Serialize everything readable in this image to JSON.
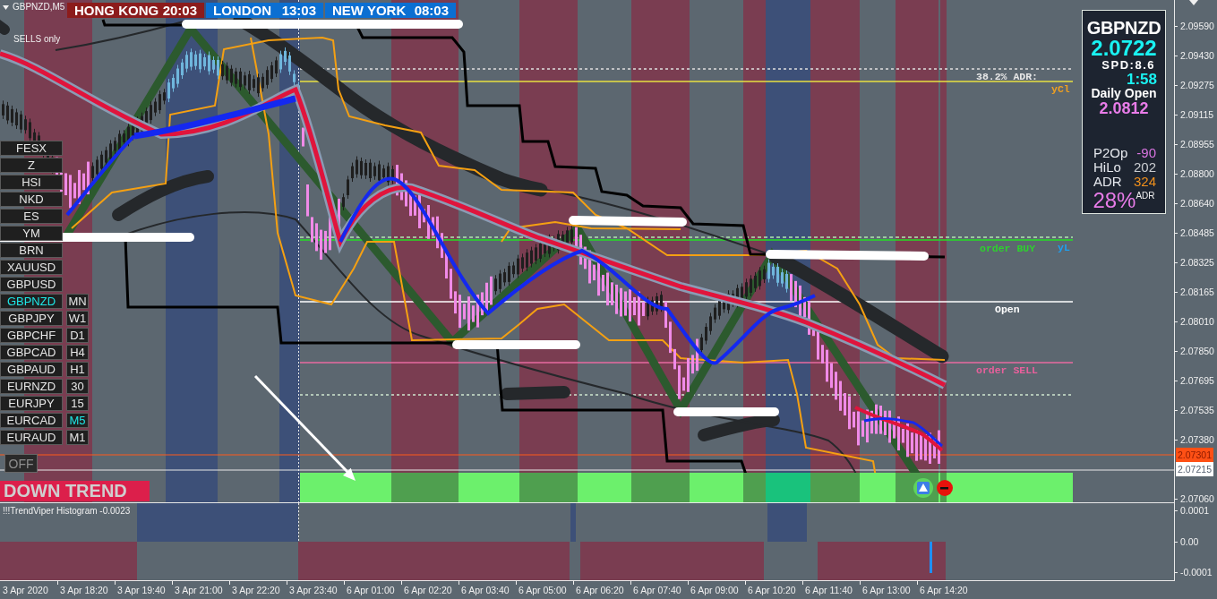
{
  "chart_header": {
    "symbol_timeframe": "GBPNZD,M5",
    "mode": "SELLS only"
  },
  "sessions": [
    {
      "name": "HONG KONG",
      "time": "20:03",
      "color": "#8c1c1c"
    },
    {
      "name": "LONDON",
      "time": "13:03",
      "color": "#0b6fd2"
    },
    {
      "name": "NEW YORK",
      "time": "08:03",
      "color": "#0b6fd2"
    }
  ],
  "info_panel": {
    "symbol": "GBPNZD",
    "price": "2.0722",
    "spread": "SPD:8.6",
    "timer": "1:58",
    "daily_open_label": "Daily Open",
    "daily_open": "2.0812",
    "stats": [
      {
        "label": "P2Op",
        "value": "-90",
        "color": "#d874e0"
      },
      {
        "label": "HiLo",
        "value": "202",
        "color": "#c9ccd0"
      },
      {
        "label": "ADR",
        "value": "324",
        "color": "#f0901c"
      }
    ],
    "adr_percent": "28%",
    "adr_percent_suffix": "ADR"
  },
  "symbols": [
    {
      "name": "FESX",
      "selected": false
    },
    {
      "name": "Z",
      "selected": false
    },
    {
      "name": "HSI",
      "selected": false
    },
    {
      "name": "NKD",
      "selected": false
    },
    {
      "name": "ES",
      "selected": false
    },
    {
      "name": "YM",
      "selected": false
    },
    {
      "name": "BRN",
      "selected": false
    },
    {
      "name": "XAUUSD",
      "selected": false
    },
    {
      "name": "GBPUSD",
      "selected": false
    },
    {
      "name": "GBPNZD",
      "selected": true
    },
    {
      "name": "GBPJPY",
      "selected": false
    },
    {
      "name": "GBPCHF",
      "selected": false
    },
    {
      "name": "GBPCAD",
      "selected": false
    },
    {
      "name": "GBPAUD",
      "selected": false
    },
    {
      "name": "EURNZD",
      "selected": false
    },
    {
      "name": "EURJPY",
      "selected": false
    },
    {
      "name": "EURCAD",
      "selected": false
    },
    {
      "name": "EURAUD",
      "selected": false
    }
  ],
  "timeframes": [
    {
      "label": "MN",
      "selected": false
    },
    {
      "label": "W1",
      "selected": false
    },
    {
      "label": "D1",
      "selected": false
    },
    {
      "label": "H4",
      "selected": false
    },
    {
      "label": "H1",
      "selected": false
    },
    {
      "label": "30",
      "selected": false
    },
    {
      "label": "15",
      "selected": false
    },
    {
      "label": "M5",
      "selected": true
    },
    {
      "label": "M1",
      "selected": false
    }
  ],
  "toggle": {
    "label": "OFF",
    "on": false
  },
  "trend_banner": "DOWN TREND",
  "level_labels": [
    {
      "kind": "adr",
      "text": "38.2% ADR:",
      "color": "#e8e8e8"
    },
    {
      "kind": "yclose",
      "text": "yCl",
      "color": "#f0a020"
    },
    {
      "kind": "buy",
      "text": "order BUY",
      "color": "#2ed12e"
    },
    {
      "kind": "ylow",
      "text": "yL",
      "color": "#1ea0f0"
    },
    {
      "kind": "open",
      "text": "Open",
      "color": "#ffffff"
    },
    {
      "kind": "sell",
      "text": "order SELL",
      "color": "#e8609c"
    }
  ],
  "price_axis": [
    {
      "kind": "tick",
      "text": "2.09590"
    },
    {
      "kind": "tick",
      "text": "2.09430"
    },
    {
      "kind": "tick",
      "text": "2.09275"
    },
    {
      "kind": "tick",
      "text": "2.09115"
    },
    {
      "kind": "tick",
      "text": "2.08955"
    },
    {
      "kind": "tick",
      "text": "2.08800"
    },
    {
      "kind": "tick",
      "text": "2.08640"
    },
    {
      "kind": "tick",
      "text": "2.08485"
    },
    {
      "kind": "tick",
      "text": "2.08325"
    },
    {
      "kind": "tick",
      "text": "2.08165"
    },
    {
      "kind": "tick",
      "text": "2.08010"
    },
    {
      "kind": "tick",
      "text": "2.07850"
    },
    {
      "kind": "tick",
      "text": "2.07695"
    },
    {
      "kind": "tick",
      "text": "2.07535"
    },
    {
      "kind": "tick",
      "text": "2.07380"
    },
    {
      "kind": "bid",
      "text": "2.07301"
    },
    {
      "kind": "line",
      "text": "2.07215"
    },
    {
      "kind": "tick",
      "text": "2.07060"
    }
  ],
  "histogram": {
    "title": "!!!TrendViper Histogram -0.0023",
    "ticks": [
      "0.0001",
      "0.00",
      "-0.0001"
    ]
  },
  "time_axis": [
    "3 Apr 2020",
    "3 Apr 18:20",
    "3 Apr 19:40",
    "3 Apr 21:00",
    "3 Apr 22:20",
    "3 Apr 23:40",
    "6 Apr 01:00",
    "6 Apr 02:20",
    "6 Apr 03:40",
    "6 Apr 05:00",
    "6 Apr 06:20",
    "6 Apr 07:40",
    "6 Apr 09:00",
    "6 Apr 10:20",
    "6 Apr 11:40",
    "6 Apr 13:00",
    "6 Apr 14:20"
  ]
}
